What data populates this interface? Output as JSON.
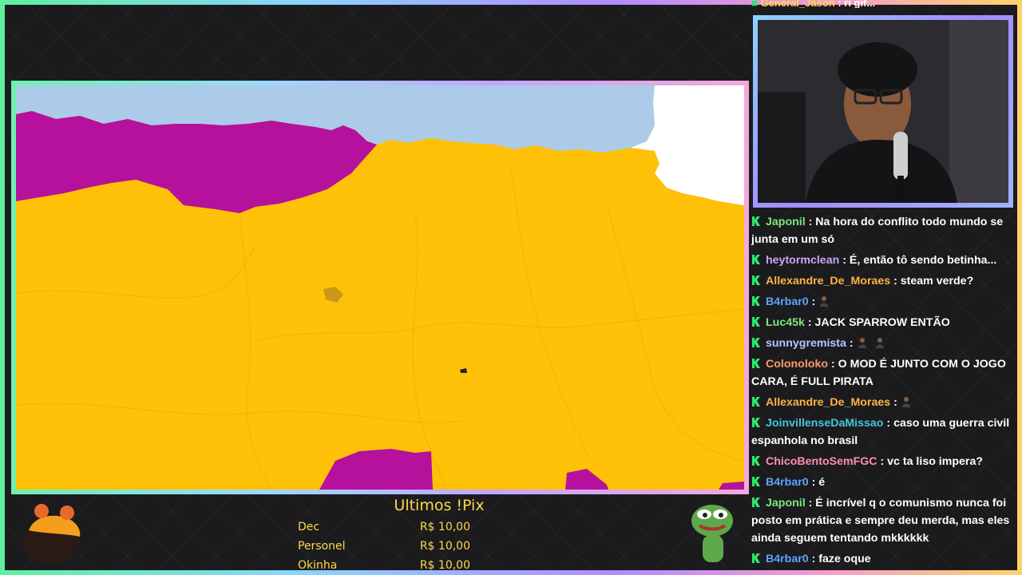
{
  "top_message": {
    "user": "General_Jason",
    "text": ": ri gif..."
  },
  "pix": {
    "title": "Ultimos !Pix",
    "entries": [
      {
        "name": "Dec",
        "amount": "R$ 10,00"
      },
      {
        "name": "Personel",
        "amount": "R$ 10,00"
      },
      {
        "name": "Okinha",
        "amount": "R$ 10,00"
      }
    ]
  },
  "chat": [
    {
      "user": "Japonil",
      "color": "#7ee87e",
      "text": ": Na hora do conflito todo mundo se junta em um só",
      "emotes": 0
    },
    {
      "user": "heytormclean",
      "color": "#c9a6ff",
      "text": ": É, então tô sendo betinha...",
      "emotes": 0
    },
    {
      "user": "Allexandre_De_Moraes",
      "color": "#ffb347",
      "text": ": steam verde?",
      "emotes": 0
    },
    {
      "user": "B4rbar0",
      "color": "#5ba3ff",
      "text": ":",
      "emotes": 1
    },
    {
      "user": "Luc45k",
      "color": "#7ee87e",
      "text": ": JACK SPARROW ENTÃO",
      "emotes": 0
    },
    {
      "user": "sunnygremista",
      "color": "#b9c4ff",
      "text": ":",
      "emotes": 2
    },
    {
      "user": "Colonoloko",
      "color": "#ff9966",
      "text": ": O MOD É JUNTO COM O JOGO CARA, É FULL PIRATA",
      "emotes": 0
    },
    {
      "user": "Allexandre_De_Moraes",
      "color": "#ffb347",
      "text": ":",
      "emotes": 1
    },
    {
      "user": "JoinvillenseDaMissao",
      "color": "#46c8d8",
      "text": ": caso uma guerra civil espanhola no brasil",
      "emotes": 0
    },
    {
      "user": "ChicoBentoSemFGC",
      "color": "#ff8fb8",
      "text": ": vc ta liso impera?",
      "emotes": 0
    },
    {
      "user": "B4rbar0",
      "color": "#5ba3ff",
      "text": ": é",
      "emotes": 0
    },
    {
      "user": "Japonil",
      "color": "#7ee87e",
      "text": ": É incrível q o comunismo nunca foi posto em prática e sempre deu merda, mas eles ainda seguem tentando mkkkkkk",
      "emotes": 0
    },
    {
      "user": "B4rbar0",
      "color": "#5ba3ff",
      "text": ": faze oque",
      "emotes": 0
    }
  ],
  "colors": {
    "map_yellow": "#ffc107",
    "map_purple": "#b5119c",
    "sea": "#abcbe8",
    "badge_green": "#2ee86f",
    "pix_text": "#ffd94a"
  },
  "icons": {
    "badge": "green-k-badge-icon",
    "emote": "person-emote-icon"
  }
}
